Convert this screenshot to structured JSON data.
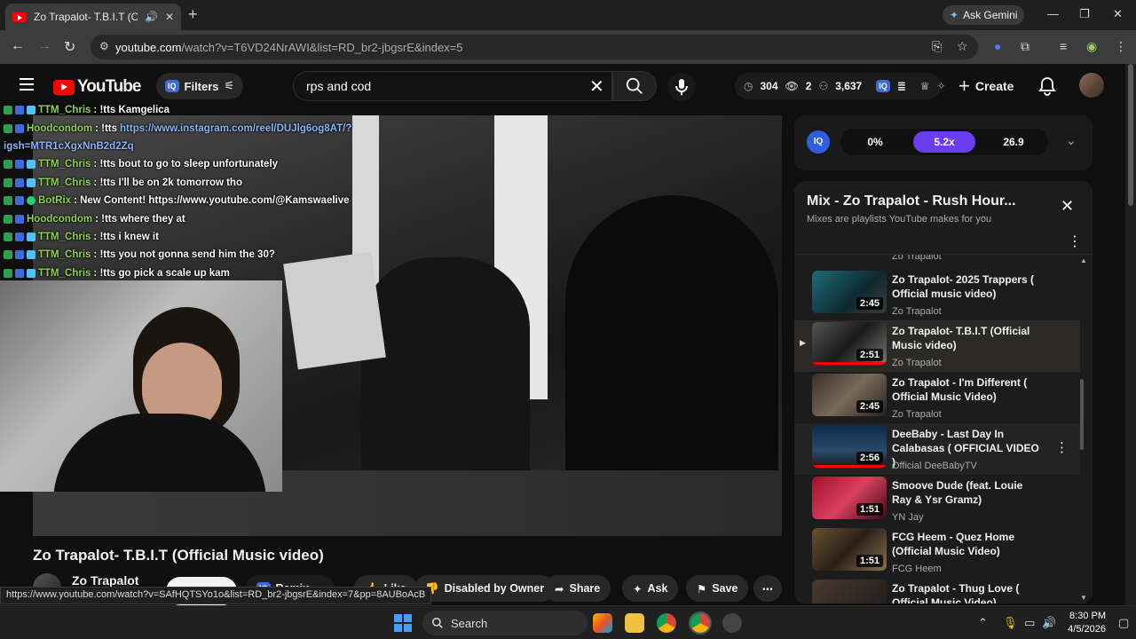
{
  "browser": {
    "tab_title": "Zo Trapalot- T.B.I.T (Official",
    "gemini_label": "Ask Gemini",
    "url_host": "youtube.com",
    "url_path": "/watch?v=T6VD24NrAWI&list=RD_br2-jbgsrE&index=5"
  },
  "header": {
    "logo_text": "YouTube",
    "filters_label": "Filters",
    "search_value": "rps and cod",
    "search_placeholder": "Search",
    "stats": {
      "views": "304",
      "watching": "2",
      "score": "3,637"
    },
    "create_label": "Create",
    "iq_badge": "IQ"
  },
  "chat": [
    {
      "name": "TTM_Chris",
      "msg": ": !tts Kamgelica",
      "link": ""
    },
    {
      "name": "Hoodcondom",
      "msg": ": !tts ",
      "link": "https://www.instagram.com/reel/DUJlg6og8AT/?"
    },
    {
      "name": "",
      "msg": "",
      "link": "igsh=MTR1cXgxNnB2d2Zq"
    },
    {
      "name": "TTM_Chris",
      "msg": ": !tts bout to go to sleep unfortunately",
      "link": ""
    },
    {
      "name": "TTM_Chris",
      "msg": ": !tts I'll be on 2k tomorrow tho",
      "link": ""
    },
    {
      "name": "BotRix",
      "msg": ": New Content! https://www.youtube.com/@Kamswaelive",
      "link": ""
    },
    {
      "name": "Hoodcondom",
      "msg": ": !tts where they at",
      "link": ""
    },
    {
      "name": "TTM_Chris",
      "msg": ": !tts i knew it",
      "link": ""
    },
    {
      "name": "TTM_Chris",
      "msg": ": !tts you not gonna send him the 30?",
      "link": ""
    },
    {
      "name": "TTM_Chris",
      "msg": ": !tts go pick a scale up kam",
      "link": ""
    }
  ],
  "video": {
    "title": "Zo Trapalot- T.B.I.T (Official Music video)",
    "channel": "Zo Trapalot",
    "subscribe_label": "Subscribe",
    "remix_label": "Remix",
    "like_label": "Like",
    "disabled_label": "Disabled by Owner",
    "share_label": "Share",
    "ask_label": "Ask",
    "save_label": "Save"
  },
  "status_url": "https://www.youtube.com/watch?v=SAfHQTSYo1o&list=RD_br2-jbgsrE&index=7&pp=8AUBoAcB",
  "iq_panel": {
    "logo": "IQ",
    "metrics": [
      "0%",
      "5.2x",
      "26.9"
    ]
  },
  "mix": {
    "title": "Mix - Zo Trapalot - Rush Hour...",
    "subtitle": "Mixes are playlists YouTube makes for you",
    "partial_channel": "Zo Trapalot",
    "items": [
      {
        "title": "Zo Trapalot- 2025 Trappers ( Official music video)",
        "channel": "Zo Trapalot",
        "duration": "2:45",
        "active": false
      },
      {
        "title": "Zo Trapalot- T.B.I.T (Official Music video)",
        "channel": "Zo Trapalot",
        "duration": "2:51",
        "active": true
      },
      {
        "title": "Zo Trapalot - I'm Different ( Official Music Video)",
        "channel": "Zo Trapalot",
        "duration": "2:45",
        "active": false
      },
      {
        "title": "DeeBaby - Last Day In Calabasas ( OFFICIAL VIDEO )",
        "channel": "Official DeeBabyTV",
        "duration": "2:56",
        "active": false
      },
      {
        "title": "Smoove Dude (feat. Louie Ray & Ysr Gramz)",
        "channel": "YN Jay",
        "duration": "1:51",
        "active": false
      },
      {
        "title": "FCG Heem - Quez Home (Official Music Video)",
        "channel": "FCG Heem",
        "duration": "1:51",
        "active": false
      },
      {
        "title": "Zo Trapalot - Thug Love ( Official Music Video)",
        "channel": "",
        "duration": "",
        "active": false
      }
    ]
  },
  "taskbar": {
    "search_label": "Search",
    "time": "8:30 PM",
    "date": "4/5/2026"
  },
  "colors": {
    "accent": "#ff0000",
    "iq_blue": "#3e6ae1",
    "metric_active": "#6b3df0",
    "chat_name": "#8fd14f",
    "link": "#8ab4f8"
  }
}
